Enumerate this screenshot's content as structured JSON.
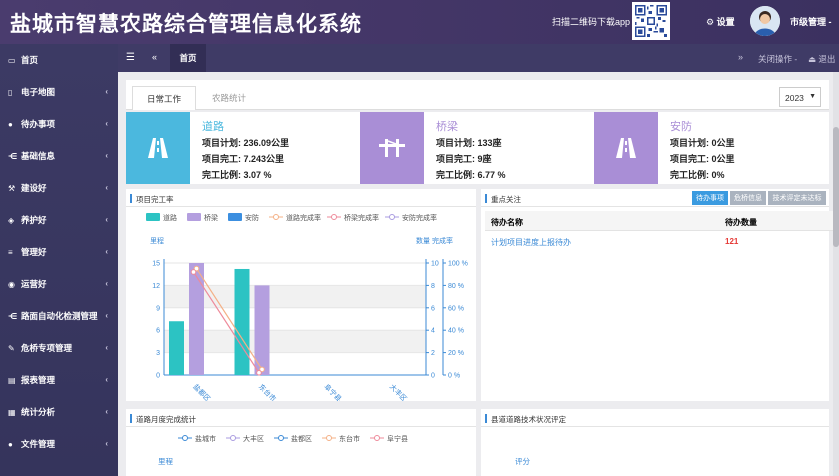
{
  "header": {
    "title": "盐城市智慧农路综合管理信息化系统",
    "qr_text": "扫描二维码下载app",
    "settings_label": "设置",
    "user_label": "市级管理 -"
  },
  "sidebar": {
    "items": [
      {
        "label": "首页",
        "icon": "monitor-icon"
      },
      {
        "label": "电子地图",
        "icon": "map-icon"
      },
      {
        "label": "待办事项",
        "icon": "chat-icon"
      },
      {
        "label": "基础信息",
        "icon": "share-icon"
      },
      {
        "label": "建设好",
        "icon": "hammer-icon"
      },
      {
        "label": "养护好",
        "icon": "shield-icon"
      },
      {
        "label": "管理好",
        "icon": "list-icon"
      },
      {
        "label": "运营好",
        "icon": "circle-icon"
      },
      {
        "label": "路面自动化检测管理",
        "icon": "share-icon"
      },
      {
        "label": "危桥专项管理",
        "icon": "wrench-icon"
      },
      {
        "label": "报表管理",
        "icon": "table-icon"
      },
      {
        "label": "统计分析",
        "icon": "grid-icon"
      },
      {
        "label": "文件管理",
        "icon": "chat-icon"
      }
    ]
  },
  "tabbar": {
    "home_tab": "首页",
    "close_ops": "关闭操作 -",
    "logout": "退出"
  },
  "subtabs": {
    "active": "日常工作",
    "second": "农路统计",
    "year": "2023"
  },
  "cards": [
    {
      "name": "道路",
      "plan_label": "项目计划:",
      "plan": "236.09公里",
      "done_label": "项目完工:",
      "done": "7.243公里",
      "ratio_label": "完工比例:",
      "ratio": "3.07 %",
      "color": "#4bb8de"
    },
    {
      "name": "桥梁",
      "plan_label": "项目计划:",
      "plan": "133座",
      "done_label": "项目完工:",
      "done": "9座",
      "ratio_label": "完工比例:",
      "ratio": "6.77 %",
      "color": "#a98ed6"
    },
    {
      "name": "安防",
      "plan_label": "项目计划:",
      "plan": "0公里",
      "done_label": "项目完工:",
      "done": "0公里",
      "ratio_label": "完工比例:",
      "ratio": "0%",
      "color": "#a98ed6"
    }
  ],
  "completion_panel": {
    "title": "项目完工率"
  },
  "focus_panel": {
    "title": "重点关注",
    "buttons": [
      "待办事项",
      "危桥信息",
      "技术评定未达标"
    ],
    "col_name": "待办名称",
    "col_count": "待办数量",
    "rows": [
      {
        "name": "计划项目进度上报待办",
        "count": "121"
      }
    ]
  },
  "monthly_panel": {
    "title": "道路月度完成统计",
    "legend": [
      "盐城市",
      "大丰区",
      "盐都区",
      "东台市",
      "阜宁县"
    ],
    "ylabel": "里程"
  },
  "tech_panel": {
    "title": "县道道路技术状况评定",
    "ylabel": "评分"
  },
  "chart_data": {
    "type": "bar",
    "categories": [
      "盐都区",
      "东台市",
      "阜宁县",
      "大丰区"
    ],
    "series": [
      {
        "name": "道路",
        "type": "bar",
        "axis": "left",
        "color": "#2cc3c3",
        "values": [
          7.2,
          14.2,
          0,
          0
        ]
      },
      {
        "name": "桥梁",
        "type": "bar",
        "axis": "left",
        "color": "#b49fdf",
        "values": [
          15,
          12,
          0,
          0
        ]
      },
      {
        "name": "安防",
        "type": "bar",
        "axis": "left",
        "color": "#3c8fe0",
        "values": [
          0,
          0,
          0,
          0
        ]
      },
      {
        "name": "道路完成率",
        "type": "line",
        "axis": "right",
        "color": "#f4b086",
        "values": [
          95,
          5,
          null,
          null
        ]
      },
      {
        "name": "桥梁完成率",
        "type": "line",
        "axis": "right",
        "color": "#ee8a9a",
        "values": [
          92,
          2,
          null,
          null
        ]
      },
      {
        "name": "安防完成率",
        "type": "line",
        "axis": "right",
        "color": "#a99be0",
        "values": [
          null,
          null,
          null,
          null
        ]
      }
    ],
    "ylabel_left": "里程",
    "ylabel_right": "数量 完成率",
    "ylim_left": [
      0,
      15
    ],
    "ylim_right_count": [
      0,
      10
    ],
    "ylim_right_rate": [
      0,
      100
    ],
    "yticks_left": [
      "0",
      "3",
      "6",
      "9",
      "12",
      "15"
    ],
    "yticks_right_count": [
      "0",
      "2",
      "4",
      "6",
      "8",
      "10"
    ],
    "yticks_right_rate": [
      "0 %",
      "20 %",
      "40 %",
      "60 %",
      "80 %",
      "100 %"
    ],
    "legend_position": "top",
    "grid": true
  }
}
